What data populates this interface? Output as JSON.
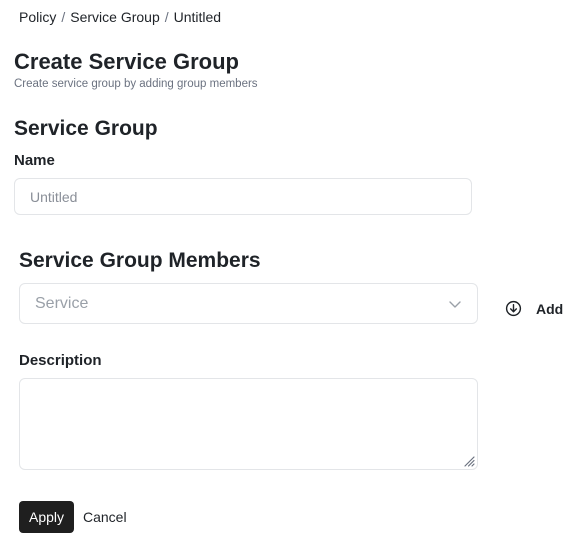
{
  "breadcrumb": {
    "items": [
      "Policy",
      "Service Group",
      "Untitled"
    ],
    "separator": "/"
  },
  "header": {
    "title": "Create Service Group",
    "subtitle": "Create service group by adding group members"
  },
  "service_group": {
    "heading": "Service Group",
    "name_label": "Name",
    "name_placeholder": "Untitled",
    "name_value": ""
  },
  "members": {
    "heading": "Service Group Members",
    "select_placeholder": "Service",
    "add_label": "Add"
  },
  "description": {
    "label": "Description",
    "value": ""
  },
  "actions": {
    "apply_label": "Apply",
    "cancel_label": "Cancel"
  },
  "icons": {
    "select_chevron": "chevron-down-icon",
    "add": "circle-arrow-down-icon",
    "resize": "resize-handle-icon"
  },
  "colors": {
    "primary_button": "#1f1f1f",
    "border": "#e3e5e8",
    "placeholder": "#9aa0a8",
    "text": "#1f2328"
  }
}
